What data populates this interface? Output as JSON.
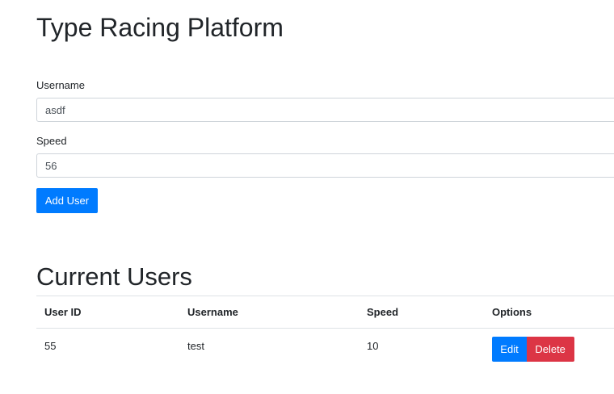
{
  "header": {
    "title": "Type Racing Platform"
  },
  "form": {
    "username_label": "Username",
    "username_value": "asdf",
    "speed_label": "Speed",
    "speed_value": "56",
    "add_button": "Add User"
  },
  "users": {
    "title": "Current Users",
    "columns": [
      "User ID",
      "Username",
      "Speed",
      "Options"
    ],
    "rows": [
      {
        "id": "55",
        "username": "test",
        "speed": "10",
        "edit_label": "Edit",
        "delete_label": "Delete"
      }
    ]
  },
  "colors": {
    "primary": "#007bff",
    "danger": "#dc3545"
  }
}
